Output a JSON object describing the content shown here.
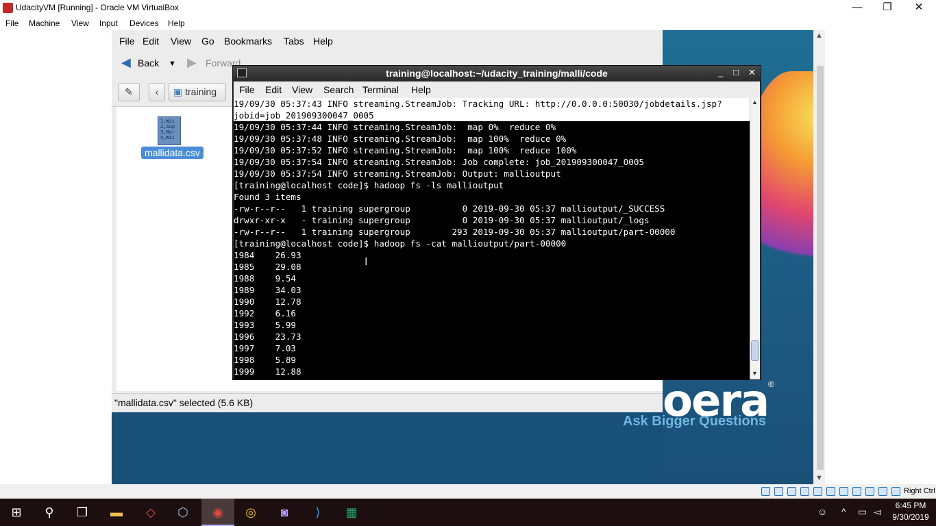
{
  "host": {
    "title": "UdacityVM [Running] - Oracle VM VirtualBox",
    "controls": {
      "minimize": "—",
      "maximize": "❐",
      "close": "✕"
    },
    "menu": [
      "File",
      "Machine",
      "View",
      "Input",
      "Devices",
      "Help"
    ]
  },
  "file_manager": {
    "menu": [
      "File",
      "Edit",
      "View",
      "Go",
      "Bookmarks",
      "Tabs",
      "Help"
    ],
    "toolbar": {
      "back": "Back",
      "forward": "Forward"
    },
    "location": {
      "back_arrow": "‹",
      "folder": "training"
    },
    "file": {
      "name": "mallidata.csv",
      "preview": [
        "1,Wii",
        "2,Sup",
        "3,Mar",
        "4,Wii"
      ]
    },
    "status": "\"mallidata.csv\" selected (5.6 KB)"
  },
  "terminal": {
    "title": "training@localhost:~/udacity_training/malli/code",
    "controls": {
      "minimize": "_",
      "maximize": "□",
      "close": "✕"
    },
    "menu": [
      "File",
      "Edit",
      "View",
      "Search",
      "Terminal",
      "Help"
    ],
    "lines": [
      "19/09/30 05:37:43 INFO streaming.StreamJob: Tracking URL: http://0.0.0.0:50030/jobdetails.jsp?",
      "jobid=job_201909300047_0005",
      "19/09/30 05:37:44 INFO streaming.StreamJob:  map 0%  reduce 0%",
      "19/09/30 05:37:48 INFO streaming.StreamJob:  map 100%  reduce 0%",
      "19/09/30 05:37:52 INFO streaming.StreamJob:  map 100%  reduce 100%",
      "19/09/30 05:37:54 INFO streaming.StreamJob: Job complete: job_201909300047_0005",
      "19/09/30 05:37:54 INFO streaming.StreamJob: Output: mallioutput",
      "[training@localhost code]$ hadoop fs -ls mallioutput",
      "Found 3 items",
      "-rw-r--r--   1 training supergroup          0 2019-09-30 05:37 mallioutput/_SUCCESS",
      "drwxr-xr-x   - training supergroup          0 2019-09-30 05:37 mallioutput/_logs",
      "-rw-r--r--   1 training supergroup        293 2019-09-30 05:37 mallioutput/part-00000",
      "[training@localhost code]$ hadoop fs -cat mallioutput/part-00000",
      "1984    26.93",
      "1985    29.08",
      "1988    9.54",
      "1989    34.03",
      "1990    12.78",
      "1992    6.16",
      "1993    5.99",
      "1996    23.73",
      "1997    7.03",
      "1998    5.89",
      "1999    12.88"
    ]
  },
  "wallpaper": {
    "logo": "oera",
    "registered": "®",
    "tagline": "Ask Bigger Questions"
  },
  "vbox_status": {
    "host_key": "Right Ctrl"
  },
  "taskbar": {
    "time": "6:45 PM",
    "date": "9/30/2019",
    "apps": [
      "start",
      "search",
      "task-view",
      "file-explorer",
      "code-app",
      "virtualbox",
      "virtualbox-vm",
      "chrome",
      "app-purple",
      "vscode",
      "excel"
    ]
  }
}
